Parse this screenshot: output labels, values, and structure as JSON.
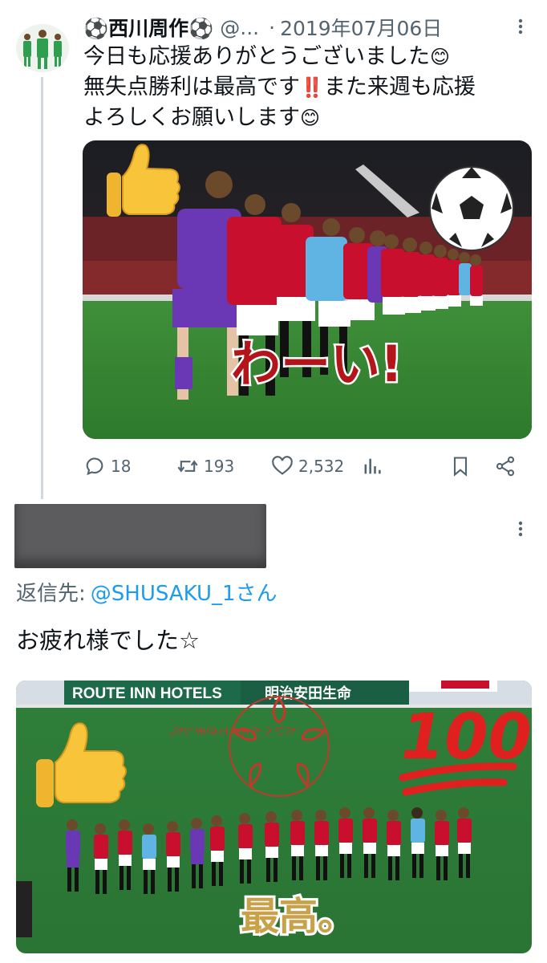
{
  "tweet": {
    "author_name": "⚽西川周作⚽",
    "handle": "@...",
    "separator": "·",
    "date": "2019年07月06日",
    "body_lines": [
      {
        "text": "今日も応援ありがとうございました",
        "emoji": "😊"
      },
      {
        "text": "無失点勝利は最高です",
        "emoji": "‼️",
        "tail": "また来週も応援"
      },
      {
        "text": "よろしくお願いします",
        "emoji": "😊"
      }
    ],
    "photo_overlay_text": "わーい!",
    "stats": {
      "replies": "18",
      "retweets": "193",
      "likes": "2,532"
    }
  },
  "reply": {
    "reply_prefix": "返信先:",
    "reply_mention": "@SHUSAKU_1さん",
    "body": "お疲れ様でした☆",
    "photo": {
      "banner_text": "ROUTE INN HOTELS",
      "banner_text_2": "明治安田生命",
      "stamp_text": "たいへんよくできました。",
      "sticker_100": "100",
      "caption": "最高。"
    }
  },
  "colors": {
    "text": "#0f1419",
    "secondary": "#536471",
    "link": "#1d9bf0",
    "thread_line": "#cfd9de",
    "redaction": "#5c5c5e",
    "urawa_red": "#c8102e"
  },
  "icons": [
    "more-icon",
    "reply-icon",
    "retweet-icon",
    "like-icon",
    "analytics-icon",
    "bookmark-icon",
    "share-icon",
    "thumbs-up-icon",
    "soccer-ball-icon"
  ]
}
